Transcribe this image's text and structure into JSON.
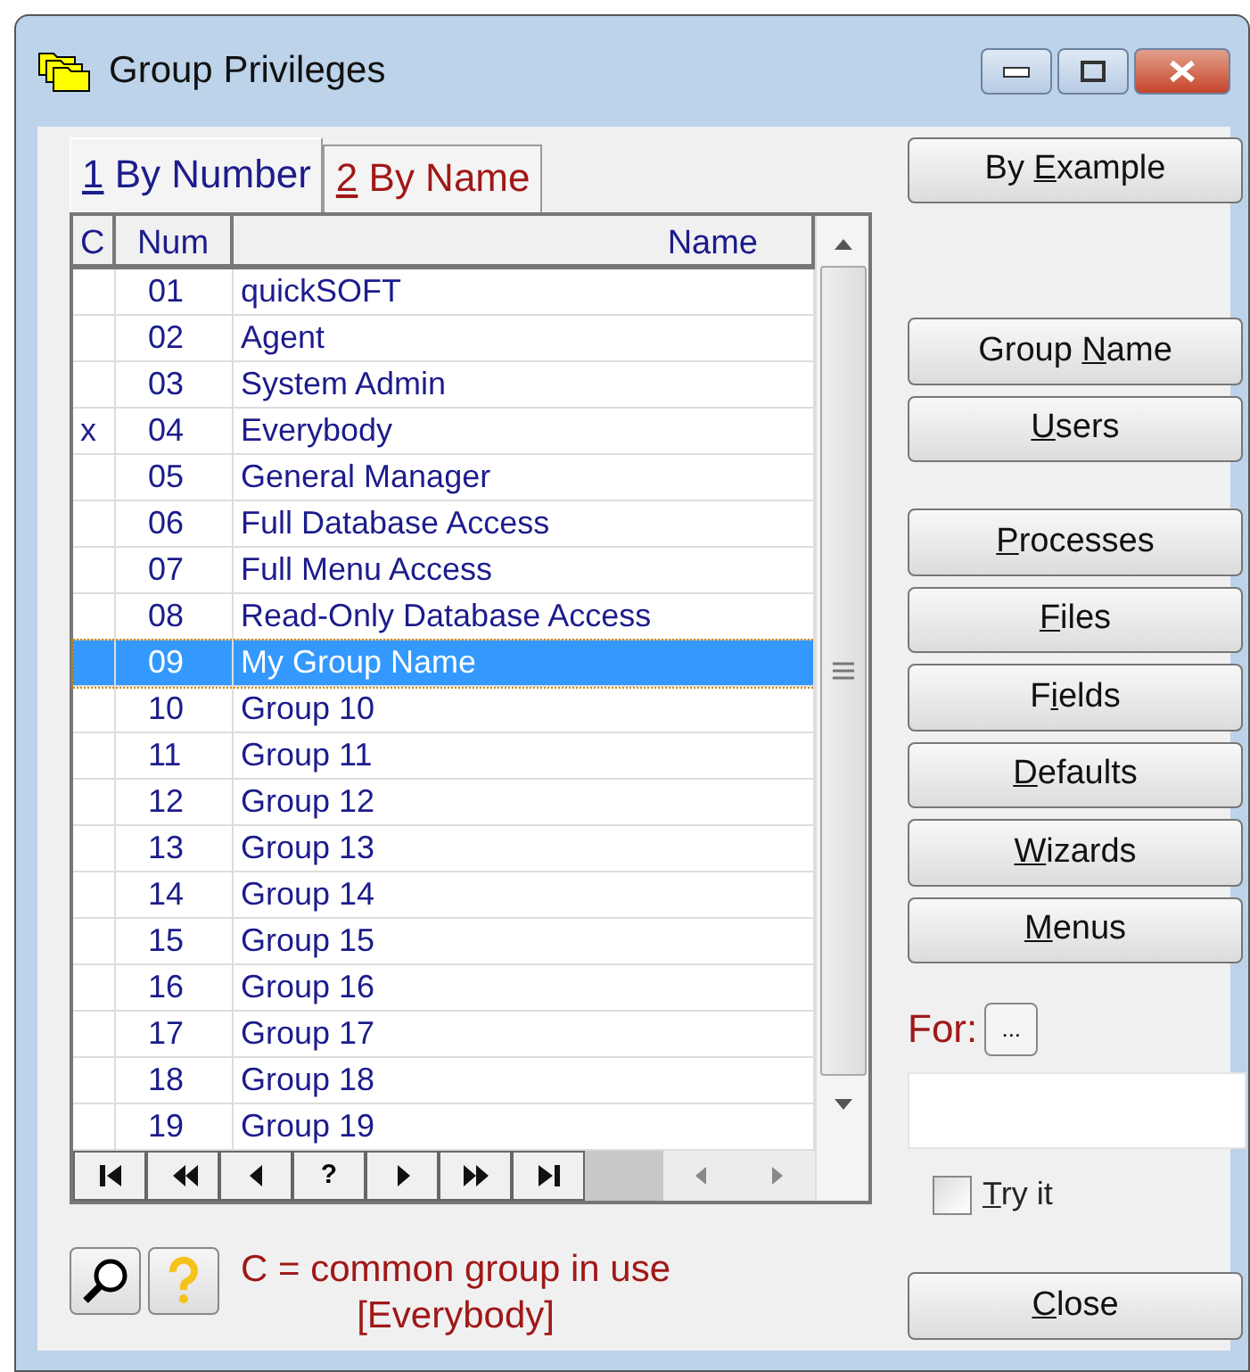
{
  "window": {
    "title": "Group Privileges"
  },
  "tabs": [
    {
      "number": "1",
      "label": " By Number",
      "selected": true
    },
    {
      "number": "2",
      "label": " By Name",
      "selected": false
    }
  ],
  "table": {
    "columns": [
      "C",
      "Num",
      "Name"
    ],
    "rows": [
      {
        "c": "",
        "num": "01",
        "name": "quickSOFT",
        "selected": false
      },
      {
        "c": "",
        "num": "02",
        "name": "Agent",
        "selected": false
      },
      {
        "c": "",
        "num": "03",
        "name": "System Admin",
        "selected": false
      },
      {
        "c": "x",
        "num": "04",
        "name": "Everybody",
        "selected": false
      },
      {
        "c": "",
        "num": "05",
        "name": "General Manager",
        "selected": false
      },
      {
        "c": "",
        "num": "06",
        "name": "Full Database Access",
        "selected": false
      },
      {
        "c": "",
        "num": "07",
        "name": "Full Menu Access",
        "selected": false
      },
      {
        "c": "",
        "num": "08",
        "name": "Read-Only Database Access",
        "selected": false
      },
      {
        "c": "",
        "num": "09",
        "name": "My Group Name",
        "selected": true
      },
      {
        "c": "",
        "num": "10",
        "name": "Group 10",
        "selected": false
      },
      {
        "c": "",
        "num": "11",
        "name": "Group 11",
        "selected": false
      },
      {
        "c": "",
        "num": "12",
        "name": "Group 12",
        "selected": false
      },
      {
        "c": "",
        "num": "13",
        "name": "Group 13",
        "selected": false
      },
      {
        "c": "",
        "num": "14",
        "name": "Group 14",
        "selected": false
      },
      {
        "c": "",
        "num": "15",
        "name": "Group 15",
        "selected": false
      },
      {
        "c": "",
        "num": "16",
        "name": "Group 16",
        "selected": false
      },
      {
        "c": "",
        "num": "17",
        "name": "Group 17",
        "selected": false
      },
      {
        "c": "",
        "num": "18",
        "name": "Group 18",
        "selected": false
      },
      {
        "c": "",
        "num": "19",
        "name": "Group 19",
        "selected": false
      }
    ]
  },
  "navigator": [
    {
      "kind": "first"
    },
    {
      "kind": "fastback"
    },
    {
      "kind": "back"
    },
    {
      "kind": "text",
      "label": "?"
    },
    {
      "kind": "next"
    },
    {
      "kind": "fastnext"
    },
    {
      "kind": "last"
    }
  ],
  "button_groups": [
    [
      {
        "before": "By ",
        "key": "E",
        "after": "xample"
      }
    ],
    [
      {
        "before": "Group ",
        "key": "N",
        "after": "ame"
      },
      {
        "key": "U",
        "after": "sers"
      }
    ],
    [
      {
        "key": "P",
        "after": "rocesses"
      },
      {
        "key": "F",
        "after": "iles"
      },
      {
        "before": "F",
        "key": "i",
        "after": "elds"
      },
      {
        "key": "D",
        "after": "efaults"
      },
      {
        "key": "W",
        "after": "izards"
      },
      {
        "key": "M",
        "after": "enus"
      }
    ]
  ],
  "for": {
    "label": "For:",
    "button": "..."
  },
  "try_it": {
    "key": "T",
    "after": "ry it",
    "checked": false
  },
  "legend": [
    "C = common group in use",
    "[Everybody]"
  ],
  "close": {
    "key": "C",
    "after": "lose"
  }
}
